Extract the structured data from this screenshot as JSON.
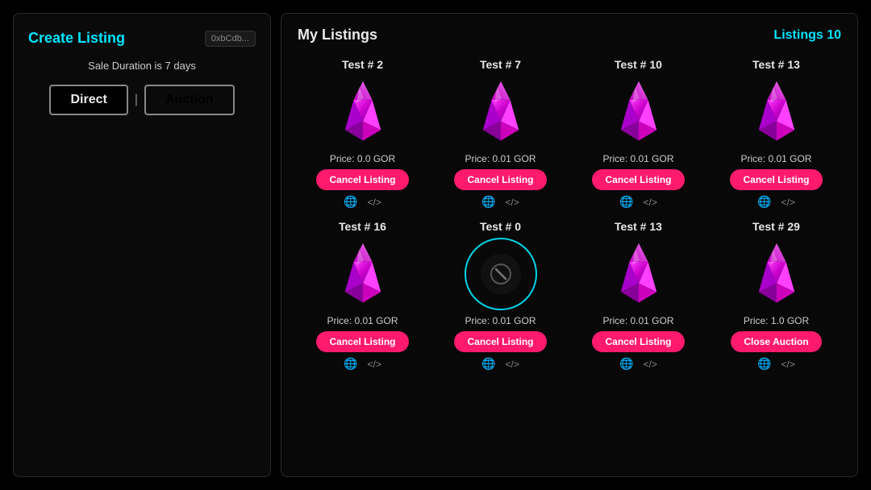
{
  "leftPanel": {
    "title": "Create Listing",
    "walletBadge": "0xbCdb...",
    "saleDuration": "Sale Duration is 7 days",
    "directBtn": "Direct",
    "auctionBtn": "Auction",
    "divider": "|"
  },
  "rightPanel": {
    "title": "My Listings",
    "listingsLabel": "Listings 10",
    "listings": [
      {
        "id": "card-1",
        "title": "Test # 2",
        "price": "Price: 0.0 GOR",
        "cancelLabel": "Cancel Listing",
        "type": "crystal"
      },
      {
        "id": "card-2",
        "title": "Test # 7",
        "price": "Price: 0.01 GOR",
        "cancelLabel": "Cancel Listing",
        "type": "crystal"
      },
      {
        "id": "card-3",
        "title": "Test # 10",
        "price": "Price: 0.01 GOR",
        "cancelLabel": "Cancel Listing",
        "type": "crystal"
      },
      {
        "id": "card-4",
        "title": "Test # 13",
        "price": "Price: 0.01 GOR",
        "cancelLabel": "Cancel Listing",
        "type": "crystal"
      },
      {
        "id": "card-5",
        "title": "Test # 16",
        "price": "Price: 0.01 GOR",
        "cancelLabel": "Cancel Listing",
        "type": "crystal"
      },
      {
        "id": "card-6",
        "title": "Test # 0",
        "price": "Price: 0.01 GOR",
        "cancelLabel": "Cancel Listing",
        "type": "auction"
      },
      {
        "id": "card-7",
        "title": "Test # 13",
        "price": "Price: 0.01 GOR",
        "cancelLabel": "Cancel Listing",
        "type": "crystal"
      },
      {
        "id": "card-8",
        "title": "Test # 29",
        "price": "Price: 1.0 GOR",
        "cancelLabel": "Close Auction",
        "type": "crystal",
        "isCloseAuction": true
      }
    ]
  }
}
